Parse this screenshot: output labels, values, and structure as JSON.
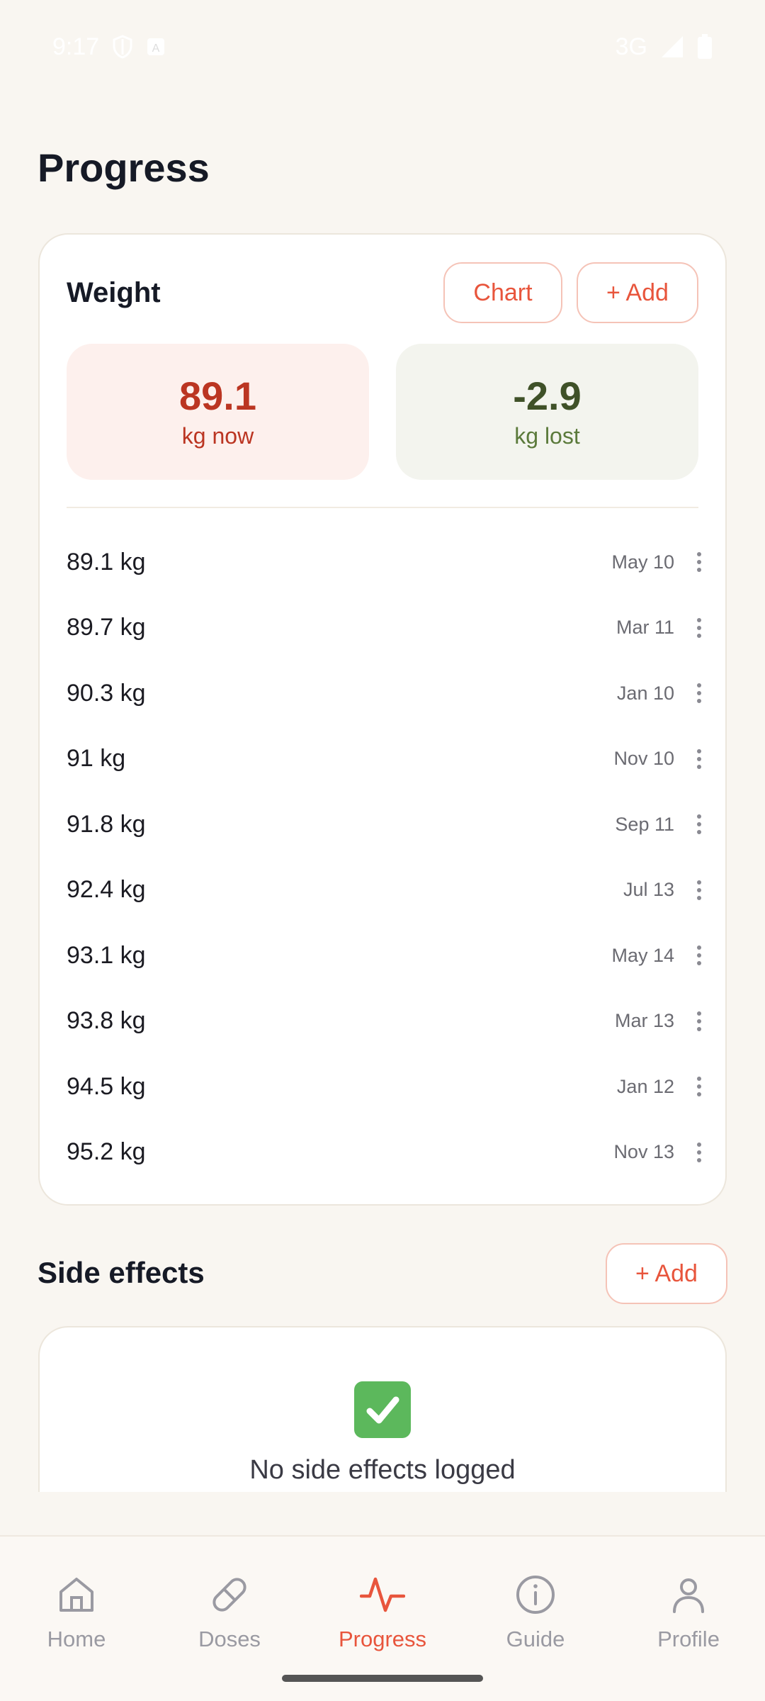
{
  "status_bar": {
    "time": "9:17",
    "network": "3G",
    "icons": [
      "shield-icon",
      "font-icon",
      "signal-icon",
      "battery-icon"
    ]
  },
  "page": {
    "title": "Progress"
  },
  "weight": {
    "title": "Weight",
    "chart_label": "Chart",
    "add_label": "+ Add",
    "current_value": "89.1",
    "current_label": "kg now",
    "lost_value": "-2.9",
    "lost_label": "kg lost",
    "entries": [
      {
        "weight": "89.1 kg",
        "date": "May 10"
      },
      {
        "weight": "89.7 kg",
        "date": "Mar 11"
      },
      {
        "weight": "90.3 kg",
        "date": "Jan 10"
      },
      {
        "weight": "91 kg",
        "date": "Nov 10"
      },
      {
        "weight": "91.8 kg",
        "date": "Sep 11"
      },
      {
        "weight": "92.4 kg",
        "date": "Jul 13"
      },
      {
        "weight": "93.1 kg",
        "date": "May 14"
      },
      {
        "weight": "93.8 kg",
        "date": "Mar 13"
      },
      {
        "weight": "94.5 kg",
        "date": "Jan 12"
      },
      {
        "weight": "95.2 kg",
        "date": "Nov 13"
      }
    ]
  },
  "side_effects": {
    "title": "Side effects",
    "add_label": "+ Add",
    "empty_text": "No side effects logged"
  },
  "nav": {
    "items": [
      {
        "label": "Home",
        "icon": "home-icon"
      },
      {
        "label": "Doses",
        "icon": "pill-icon"
      },
      {
        "label": "Progress",
        "icon": "activity-icon"
      },
      {
        "label": "Guide",
        "icon": "info-icon"
      },
      {
        "label": "Profile",
        "icon": "profile-icon"
      }
    ],
    "active": "Progress"
  },
  "colors": {
    "accent": "#e8553c",
    "background": "#f9f6f1",
    "now_value": "#bb3522",
    "lost_value": "#3f5128"
  }
}
